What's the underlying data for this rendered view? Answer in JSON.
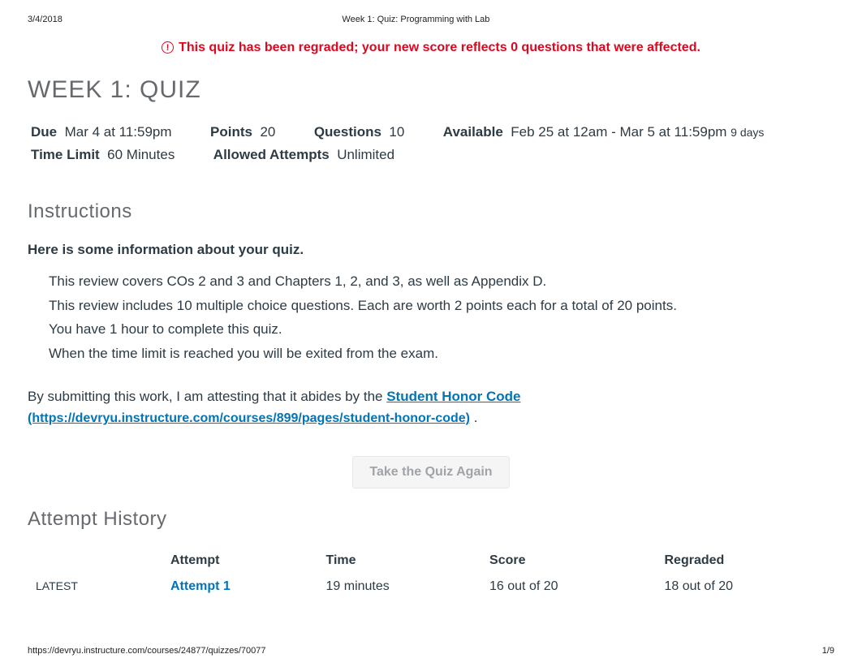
{
  "print_header": {
    "date": "3/4/2018",
    "title": "Week 1: Quiz: Programming with Lab"
  },
  "regrade_banner": {
    "text": "This quiz has been regraded; your new score reflects 0 questions that were affected."
  },
  "quiz_title": "WEEK 1: QUIZ",
  "meta": {
    "due_label": "Due",
    "due_value": "Mar 4 at 11:59pm",
    "points_label": "Points",
    "points_value": "20",
    "questions_label": "Questions",
    "questions_value": "10",
    "available_label": "Available",
    "available_value": "Feb 25 at 12am - Mar 5 at 11:59pm",
    "available_duration": "9 days",
    "time_limit_label": "Time Limit",
    "time_limit_value": "60 Minutes",
    "allowed_attempts_label": "Allowed Attempts",
    "allowed_attempts_value": "Unlimited"
  },
  "instructions": {
    "heading": "Instructions",
    "lead": "Here is some information about your quiz.",
    "bullets": [
      "This review covers COs 2 and 3 and Chapters 1, 2, and 3, as well as Appendix D.",
      "This review includes 10 multiple choice questions. Each are worth 2 points each for a total of 20 points.",
      "You have 1 hour to complete this quiz.",
      "When the time limit is reached you will be exited from the exam."
    ],
    "attest_prefix": "By submitting this work, I am attesting that it abides by the ",
    "honor_link_text": "Student Honor Code",
    "honor_link_url": "(https://devryu.instructure.com/courses/899/pages/student-honor-code)",
    "attest_suffix": " ."
  },
  "buttons": {
    "take_again": "Take the Quiz Again"
  },
  "attempt_history": {
    "heading": "Attempt History",
    "columns": {
      "attempt": "Attempt",
      "time": "Time",
      "score": "Score",
      "regraded": "Regraded"
    },
    "rows": [
      {
        "latest_label": "LATEST",
        "attempt_link": "Attempt 1",
        "time": "19 minutes",
        "score": "16 out of 20",
        "regraded": "18 out of 20"
      }
    ]
  },
  "print_footer": {
    "url": "https://devryu.instructure.com/courses/24877/quizzes/70077",
    "page": "1/9"
  }
}
